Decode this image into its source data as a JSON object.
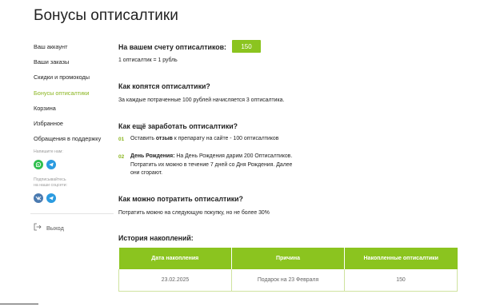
{
  "page": {
    "title": "Бонусы оптисалтики"
  },
  "sidebar": {
    "items": [
      {
        "label": "Ваш аккаунт",
        "active": false
      },
      {
        "label": "Ваши заказы",
        "active": false
      },
      {
        "label": "Скидки и промокоды",
        "active": false
      },
      {
        "label": "Бонусы оптисалтики",
        "active": true
      },
      {
        "label": "Корзина",
        "active": false
      },
      {
        "label": "Избранное",
        "active": false
      },
      {
        "label": "Обращения в поддержку",
        "active": false
      }
    ],
    "write_us_label": "Напишите нам:",
    "write_us_icons": [
      "whatsapp-icon",
      "telegram-icon"
    ],
    "subscribe_label": "Подписывайтесь\nна наши соцсети:",
    "subscribe_icons": [
      "vk-icon",
      "telegram-icon"
    ],
    "logout_label": "Выход"
  },
  "balance": {
    "label": "На вашем счету оптисалтиков:",
    "value": "150",
    "rate": "1 оптисалтик = 1 рубль"
  },
  "earn": {
    "heading": "Как копятся оптисалтики?",
    "text": "За каждые потраченные 100 рублей начисляется 3 оптисалтика."
  },
  "more": {
    "heading": "Как ещё заработать оптисалтики?",
    "items": [
      {
        "num": "01",
        "prefix": "Оставить ",
        "bold": "отзыв",
        "suffix": " к препарату на сайте - 100 оптисалтиков"
      },
      {
        "num": "02",
        "bold": "День Рождения:",
        "line1": " На День Рождения дарим 200 Оптисалтиков.",
        "line2": "Потратить их можно в течение 7 дней со Дня Рождения. Далее",
        "line3": "они сгорают."
      }
    ]
  },
  "spend": {
    "heading": "Как можно потратить оптисалтики?",
    "text": "Потратить можно на следующую покупку, но не более 30%"
  },
  "history": {
    "heading": "История накоплений:",
    "columns": [
      "Дата накопления",
      "Причина",
      "Накопленные оптисалтики"
    ],
    "rows": [
      [
        "23.02.2025",
        "Подарок на 23 Февраля",
        "150"
      ]
    ]
  },
  "colors": {
    "accent": "#8bc41f",
    "active_text": "#8ab51f",
    "whatsapp": "#2fbf4d",
    "telegram": "#2b9be0",
    "vk": "#4a7ab0"
  }
}
